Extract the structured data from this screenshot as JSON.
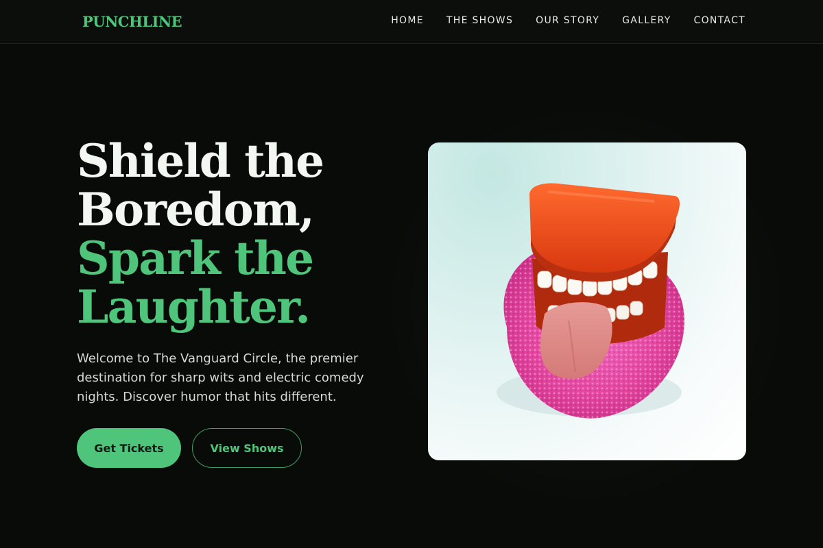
{
  "header": {
    "logo": "PUNCHLINE",
    "nav": [
      "HOME",
      "THE SHOWS",
      "OUR STORY",
      "GALLERY",
      "CONTACT"
    ]
  },
  "hero": {
    "headline_white": [
      "Shield the",
      "Boredom,"
    ],
    "headline_green": [
      "Spark the",
      "Laughter."
    ],
    "intro": "Welcome to The Vanguard Circle, the premier destination for sharp wits and electric comedy nights. Discover humor that hits different.",
    "primary_button": "Get Tickets",
    "secondary_button": "View Shows"
  },
  "image": {
    "subject": "wind-up chattering teeth toy with tongue on pink sponge",
    "icon": "chattering-teeth-photo"
  },
  "colors": {
    "background": "#090b09",
    "accent": "#4ec57a",
    "text": "#f2f7f1"
  }
}
